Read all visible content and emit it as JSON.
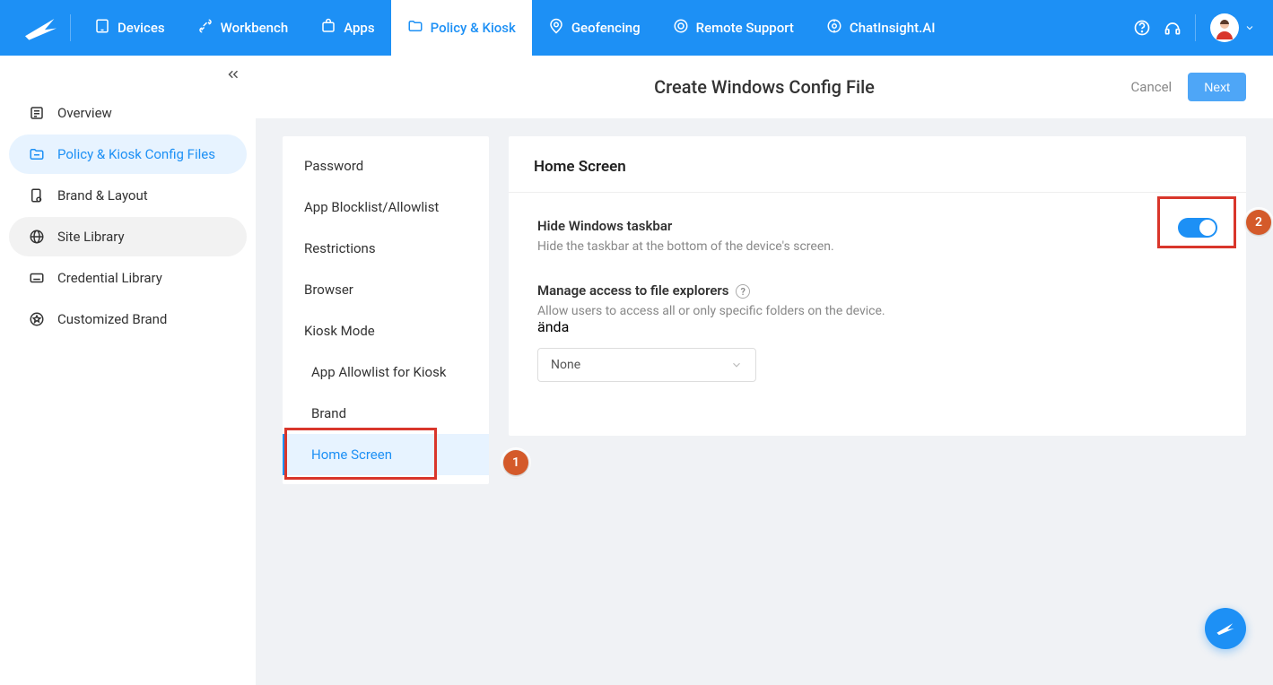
{
  "topnav": {
    "items": [
      {
        "label": "Devices"
      },
      {
        "label": "Workbench"
      },
      {
        "label": "Apps"
      },
      {
        "label": "Policy & Kiosk"
      },
      {
        "label": "Geofencing"
      },
      {
        "label": "Remote Support"
      },
      {
        "label": "ChatInsight.AI"
      }
    ]
  },
  "sidebar": {
    "items": [
      {
        "label": "Overview"
      },
      {
        "label": "Policy & Kiosk Config Files"
      },
      {
        "label": "Brand & Layout"
      },
      {
        "label": "Site Library"
      },
      {
        "label": "Credential Library"
      },
      {
        "label": "Customized Brand"
      }
    ]
  },
  "page": {
    "title": "Create Windows Config File",
    "cancel": "Cancel",
    "next": "Next"
  },
  "configNav": {
    "items": [
      {
        "label": "Password"
      },
      {
        "label": "App Blocklist/Allowlist"
      },
      {
        "label": "Restrictions"
      },
      {
        "label": "Browser"
      },
      {
        "label": "Kiosk Mode"
      },
      {
        "label": "App Allowlist for Kiosk"
      },
      {
        "label": "Brand"
      },
      {
        "label": "Home Screen"
      }
    ]
  },
  "panel": {
    "title": "Home Screen",
    "setting1": {
      "title": "Hide Windows taskbar",
      "desc": "Hide the taskbar at the bottom of the device's screen."
    },
    "setting2": {
      "title": "Manage access to file explorers",
      "desc": "Allow users to access all or only specific folders on the device.",
      "selectValue": "None"
    }
  },
  "callouts": {
    "c1": "1",
    "c2": "2"
  }
}
